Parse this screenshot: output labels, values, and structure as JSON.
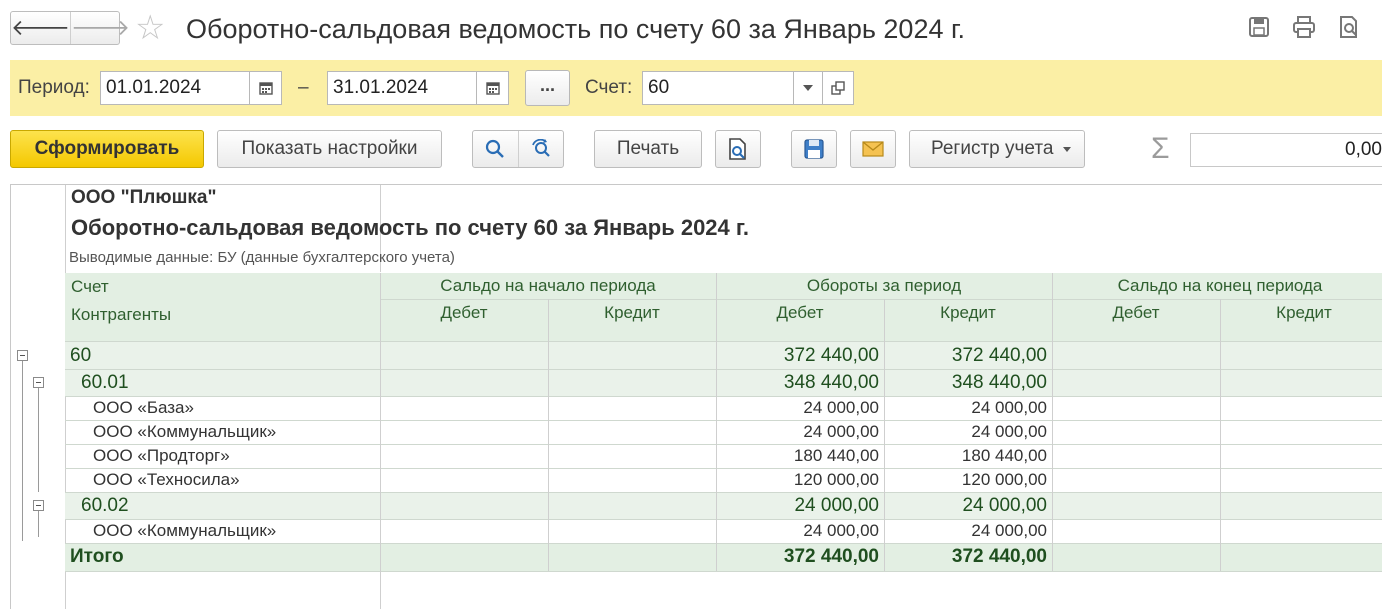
{
  "window": {
    "title": "Оборотно-сальдовая ведомость по счету 60 за Январь 2024 г.",
    "back_icon": "arrow-left-icon",
    "forward_icon": "arrow-right-icon",
    "favorite_icon": "star-icon",
    "top_icons": [
      "save-icon",
      "print-icon",
      "preview-icon"
    ]
  },
  "params": {
    "period_label": "Период:",
    "date_from": "01.01.2024",
    "date_separator": "–",
    "date_to": "31.01.2024",
    "ellipsis_label": "...",
    "account_label": "Счет:",
    "account_value": "60"
  },
  "toolbar": {
    "generate_label": "Сформировать",
    "settings_label": "Показать настройки",
    "print_label": "Печать",
    "register_label": "Регистр учета",
    "sum_symbol": "Σ",
    "sum_value": "0,00"
  },
  "report": {
    "organization": "ООО \"Плюшка\"",
    "title": "Оборотно-сальдовая ведомость по счету 60 за Январь 2024 г.",
    "subtitle": "Выводимые данные: БУ (данные бухгалтерского учета)",
    "headers": {
      "account": "Счет",
      "counterparties": "Контрагенты",
      "opening": "Сальдо на начало периода",
      "turnover": "Обороты за период",
      "closing": "Сальдо на конец периода",
      "debit": "Дебет",
      "credit": "Кредит"
    },
    "rows": [
      {
        "name": "60",
        "turn_debit": "372 440,00",
        "turn_credit": "372 440,00"
      },
      {
        "name": "60.01",
        "turn_debit": "348 440,00",
        "turn_credit": "348 440,00"
      },
      {
        "name": "ООО «База»",
        "turn_debit": "24 000,00",
        "turn_credit": "24 000,00"
      },
      {
        "name": "ООО «Коммунальщик»",
        "turn_debit": "24 000,00",
        "turn_credit": "24 000,00"
      },
      {
        "name": "ООО «Продторг»",
        "turn_debit": "180 440,00",
        "turn_credit": "180 440,00"
      },
      {
        "name": "ООО «Техносила»",
        "turn_debit": "120 000,00",
        "turn_credit": "120 000,00"
      },
      {
        "name": "60.02",
        "turn_debit": "24 000,00",
        "turn_credit": "24 000,00"
      },
      {
        "name": "ООО «Коммунальщик»",
        "turn_debit": "24 000,00",
        "turn_credit": "24 000,00"
      }
    ],
    "total": {
      "name": "Итого",
      "turn_debit": "372 440,00",
      "turn_credit": "372 440,00"
    }
  },
  "colors": {
    "params_band": "#fbefa5",
    "primary_button": "#f4c800",
    "header_green": "#e3efe3",
    "group_row": "#eaf2ea"
  }
}
